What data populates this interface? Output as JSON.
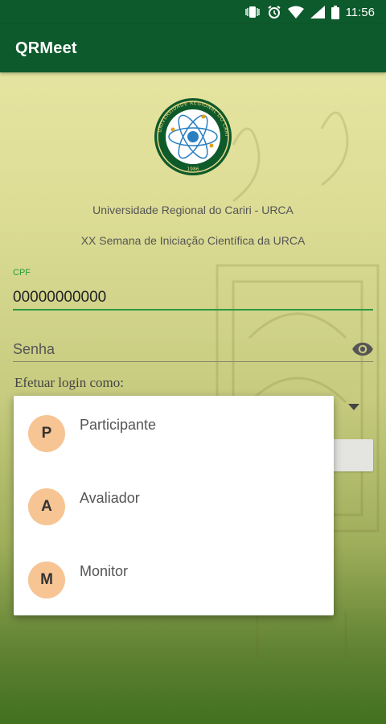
{
  "status_bar": {
    "time": "11:56",
    "icons": [
      "vibrate-icon",
      "alarm-icon",
      "wifi-icon",
      "signal-icon",
      "battery-icon"
    ]
  },
  "app_bar": {
    "title": "QRMeet"
  },
  "logo": {
    "icon": "atom-seal-icon",
    "ring_text": "UNIVERSIDADE REGIONAL DO CARIRI",
    "year": "1986"
  },
  "header": {
    "university": "Universidade Regional do Cariri - URCA",
    "event": "XX Semana de Iniciação Científica da URCA"
  },
  "form": {
    "cpf_label": "CPF",
    "cpf_value": "00000000000",
    "password_placeholder": "Senha",
    "login_as_label": "Efetuar login como:"
  },
  "menu": {
    "items": [
      {
        "initial": "P",
        "label": "Participante"
      },
      {
        "initial": "A",
        "label": "Avaliador"
      },
      {
        "initial": "M",
        "label": "Monitor"
      }
    ]
  },
  "colors": {
    "primary": "#0d5a2c",
    "accent": "#2a9a3f",
    "avatar": "#f7c493"
  }
}
